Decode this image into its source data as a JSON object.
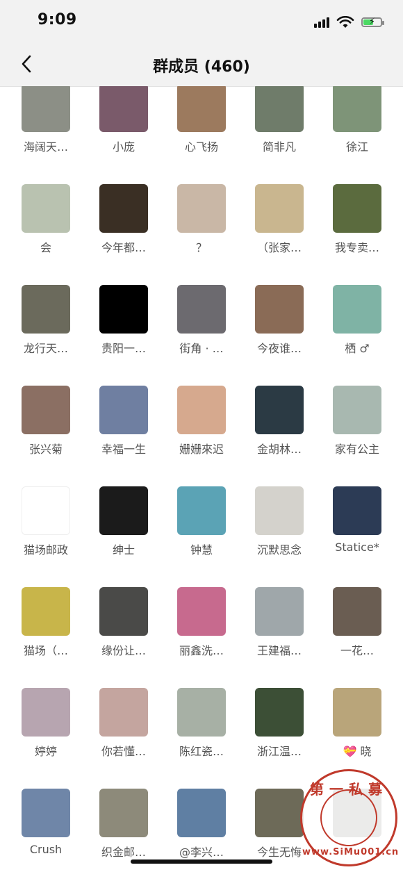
{
  "status": {
    "time": "9:09"
  },
  "header": {
    "title": "群成员 (460)"
  },
  "members": [
    {
      "name": "海阔天…",
      "color": "#8c8f86"
    },
    {
      "name": "小庞",
      "color": "#7a5a6a"
    },
    {
      "name": "心飞扬",
      "color": "#9c7a5e"
    },
    {
      "name": "简非凡",
      "color": "#6f7c6a"
    },
    {
      "name": "徐江",
      "color": "#7e9478"
    },
    {
      "name": "会",
      "color": "#b9c2b0"
    },
    {
      "name": "今年都…",
      "color": "#3a2f24"
    },
    {
      "name": "？",
      "color": "#c9b7a6"
    },
    {
      "name": "（张家…",
      "color": "#c9b68f"
    },
    {
      "name": "我专卖…",
      "color": "#5b6b3e"
    },
    {
      "name": "龙行天…",
      "color": "#6b6a5c"
    },
    {
      "name": "贵阳一…",
      "color": "#000000"
    },
    {
      "name": "街角 · …",
      "color": "#6c6a6f"
    },
    {
      "name": "今夜谁…",
      "color": "#8a6b56"
    },
    {
      "name": "栖 ♂",
      "color": "#7fb3a5"
    },
    {
      "name": "张兴菊",
      "color": "#8b6f63"
    },
    {
      "name": "幸福一生",
      "color": "#6f7fa1"
    },
    {
      "name": "姗姗來迟",
      "color": "#d6a98e"
    },
    {
      "name": "金胡林…",
      "color": "#2b3a44"
    },
    {
      "name": "家有公主",
      "color": "#a8b8b0"
    },
    {
      "name": "猫场邮政",
      "color": "#ffffff"
    },
    {
      "name": "绅士",
      "color": "#1b1b1b"
    },
    {
      "name": "钟慧",
      "color": "#5ba3b5"
    },
    {
      "name": "沉默思念",
      "color": "#d4d2cc"
    },
    {
      "name": "Statice*",
      "color": "#2c3b55"
    },
    {
      "name": "猫场（…",
      "color": "#c8b54a"
    },
    {
      "name": "缘份让…",
      "color": "#4a4a48"
    },
    {
      "name": "丽鑫洗…",
      "color": "#c76a8e"
    },
    {
      "name": "王建福…",
      "color": "#9fa7aa"
    },
    {
      "name": "一花…",
      "color": "#6a5d52"
    },
    {
      "name": "婷婷",
      "color": "#b7a5b0"
    },
    {
      "name": "你若懂…",
      "color": "#c4a59f"
    },
    {
      "name": "陈红瓷…",
      "color": "#a7b0a5"
    },
    {
      "name": "浙江温…",
      "color": "#3c4f36"
    },
    {
      "name": "💝 晓",
      "color": "#b9a57a"
    },
    {
      "name": "Crush",
      "color": "#6f86a8"
    },
    {
      "name": "织金邮…",
      "color": "#8d8a7a"
    },
    {
      "name": "@李兴…",
      "color": "#5f7fa3"
    },
    {
      "name": "今生无悔",
      "color": "#6d6a58"
    },
    {
      "name": "",
      "color": "#7a7a72"
    }
  ],
  "watermark": {
    "top_text": "第一私募",
    "bottom_text": "www.SiMu001.cn"
  }
}
